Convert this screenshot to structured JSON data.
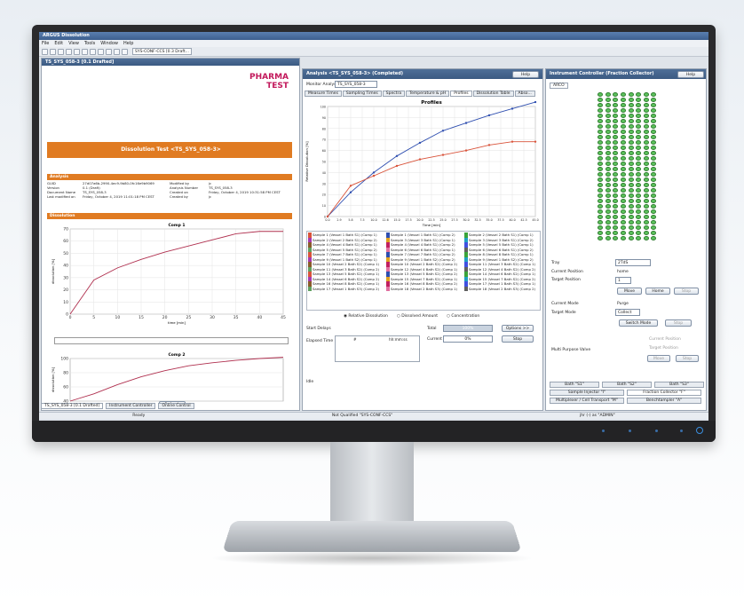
{
  "app": {
    "title": "ARGUS Dissolution",
    "menu": [
      "File",
      "Edit",
      "View",
      "Tools",
      "Window",
      "Help"
    ],
    "config_combo": "SYS-CONF-CCS [0.3 Draft..."
  },
  "left_pane": {
    "title": "TS_SYS_058-3 [0.1 Drafted]",
    "logo": "PHARMA TEST",
    "banner": "Dissolution Test <TS_SYS_058-3>",
    "analysis_header": "Analysis",
    "analysis_rows": [
      {
        "k1": "GUID",
        "v1": "27d07a6b-2990-4ec9-9b80-0fc16e9b9069",
        "k2": "Modified by",
        "v2": "jc"
      },
      {
        "k1": "Version",
        "v1": "0.1 (Draft)",
        "k2": "Analysis Number",
        "v2": "TS_SYS_058-3"
      },
      {
        "k1": "Document Name",
        "v1": "TS_SYS_058-3",
        "k2": "Created on",
        "v2": "Friday, October 4, 2019 10:31:58 PM CEST"
      },
      {
        "k1": "Last modified on",
        "v1": "Friday, October 4, 2019 11:01:18 PM CEST",
        "k2": "Created by",
        "v2": "jc"
      }
    ],
    "dissolution_header": "Dissolution",
    "refresh": "Refresh",
    "bottom_tabs": [
      "TS_SYS_058-3 [0.1 Drafted]",
      "Instrument Controller",
      "Online Control"
    ]
  },
  "chart_left1": {
    "chart_data": {
      "type": "line",
      "title": "Comp 1",
      "xlabel": "time [min]",
      "ylabel": "dissolution [%]",
      "x": [
        0,
        5,
        10,
        15,
        20,
        25,
        30,
        35,
        40,
        45
      ],
      "xticks": [
        "0",
        "5",
        "10",
        "15",
        "20",
        "25",
        "30",
        "35",
        "40",
        "45"
      ],
      "yticks": [
        "0",
        "10",
        "20",
        "30",
        "40",
        "50",
        "60",
        "70"
      ],
      "ylim": [
        0,
        70
      ],
      "series": [
        {
          "values": [
            0,
            28,
            38,
            45,
            51,
            56,
            61,
            66,
            68,
            68
          ]
        }
      ]
    }
  },
  "chart_left2": {
    "chart_data": {
      "type": "line",
      "title": "Comp 2",
      "ylabel": "dissolution [%]",
      "yticks": [
        "40",
        "60",
        "80",
        "100"
      ],
      "ylim": [
        30,
        100
      ],
      "x": [
        0,
        5,
        10,
        15,
        20,
        25,
        30,
        35,
        40,
        45
      ],
      "series": [
        {
          "values": [
            30,
            42,
            57,
            70,
            80,
            88,
            93,
            97,
            100,
            102
          ]
        }
      ]
    }
  },
  "middle_pane": {
    "title": "Analysis <TS_SYS_058-3> (Completed)",
    "help": "Help",
    "monitor_label": "Monitor Analysis",
    "monitor_value": "TS_SYS_058-3",
    "tabs": [
      "Measure Times",
      "Sampling Times",
      "Spectra",
      "Temperature & pH",
      "Profiles",
      "Dissolution Table",
      "Abso..."
    ],
    "active_tab": "Profiles",
    "radio": [
      "Relative Dissolution",
      "Dissolved Amount",
      "Concentration"
    ],
    "start_delays": "Start Delays",
    "total": "Total",
    "elapsed": "Elapsed Time",
    "hash": "#",
    "hhmmss": "hh:mm:ss",
    "current": "Current",
    "total_pct": "100%",
    "current_pct": "0%",
    "options": "Options >>",
    "stop": "Stop",
    "idle": "Idle"
  },
  "profiles_chart": {
    "chart_data": {
      "type": "line",
      "title": "Profiles",
      "xlabel": "Time [min]",
      "ylabel": "Relative Dissolution [%]",
      "ylim": [
        0,
        100
      ],
      "yticks": [
        "0",
        "10",
        "20",
        "30",
        "40",
        "50",
        "60",
        "70",
        "80",
        "90",
        "100"
      ],
      "xticks": [
        "0.0",
        "2.9",
        "5.8",
        "7.5",
        "10.0",
        "12.6",
        "15.0",
        "17.5",
        "20.0",
        "22.5",
        "25.0",
        "27.5",
        "30.0",
        "32.5",
        "35.0",
        "37.5",
        "40.0",
        "42.5",
        "45.0"
      ],
      "x": [
        0,
        5,
        10,
        15,
        20,
        25,
        30,
        35,
        40,
        45
      ],
      "series": [
        {
          "color": "#2f4fb0",
          "values": [
            0,
            22,
            40,
            55,
            67,
            78,
            85,
            92,
            98,
            104
          ]
        },
        {
          "color": "#d9533a",
          "values": [
            0,
            28,
            37,
            46,
            52,
            56,
            60,
            65,
            68,
            68
          ]
        }
      ]
    }
  },
  "legend": [
    [
      "Sample 1 (Vessel 1 Bath S1) (Comp 1)",
      "Sample 1 (Vessel 1 Bath S1) (Comp 2)",
      "Sample 2 (Vessel 2 Bath S1) (Comp 1)"
    ],
    [
      "Sample 2 (Vessel 2 Bath S1) (Comp 2)",
      "Sample 3 (Vessel 3 Bath S1) (Comp 1)",
      "Sample 3 (Vessel 3 Bath S1) (Comp 2)"
    ],
    [
      "Sample 4 (Vessel 4 Bath S1) (Comp 1)",
      "Sample 4 (Vessel 4 Bath S1) (Comp 2)",
      "Sample 5 (Vessel 5 Bath S1) (Comp 1)"
    ],
    [
      "Sample 5 (Vessel 5 Bath S1) (Comp 2)",
      "Sample 6 (Vessel 6 Bath S1) (Comp 1)",
      "Sample 6 (Vessel 6 Bath S1) (Comp 2)"
    ],
    [
      "Sample 7 (Vessel 7 Bath S1) (Comp 1)",
      "Sample 7 (Vessel 7 Bath S1) (Comp 2)",
      "Sample 8 (Vessel 8 Bath S1) (Comp 1)"
    ],
    [
      "Sample 9 (Vessel 1 Bath S2) (Comp 1)",
      "Sample 9 (Vessel 1 Bath S2) (Comp 2)",
      "Sample 9 (Vessel 1 Bath S2) (Comp 2)"
    ],
    [
      "Sample 10 (Vessel 2 Bath S2) (Comp 1)",
      "Sample 10 (Vessel 2 Bath S2) (Comp 2)",
      "Sample 11 (Vessel 3 Bath S2) (Comp 1)"
    ],
    [
      "Sample 11 (Vessel 3 Bath S2) (Comp 2)",
      "Sample 12 (Vessel 4 Bath S2) (Comp 1)",
      "Sample 12 (Vessel 4 Bath S2) (Comp 2)"
    ],
    [
      "Sample 13 (Vessel 5 Bath S2) (Comp 1)",
      "Sample 13 (Vessel 5 Bath S2) (Comp 2)",
      "Sample 14 (Vessel 6 Bath S2) (Comp 1)"
    ],
    [
      "Sample 14 (Vessel 6 Bath S2) (Comp 2)",
      "Sample 15 (Vessel 7 Bath S2) (Comp 1)",
      "Sample 15 (Vessel 7 Bath S2) (Comp 2)"
    ],
    [
      "Sample 16 (Vessel 8 Bath S2) (Comp 1)",
      "Sample 16 (Vessel 8 Bath S2) (Comp 2)",
      "Sample 17 (Vessel 1 Bath S3) (Comp 1)"
    ],
    [
      "Sample 17 (Vessel 1 Bath S3) (Comp 2)",
      "Sample 18 (Vessel 2 Bath S3) (Comp 1)",
      "Sample 18 (Vessel 2 Bath S3) (Comp 2)"
    ]
  ],
  "right_pane": {
    "title": "Instrument Controller (Fraction Collector)",
    "help": "Help",
    "tab": "ARCO",
    "tray": "Tray",
    "tray_value": "2TdS",
    "current_position": "Current Position",
    "current_position_value": "home",
    "target_position": "Target Position",
    "target_value": "1",
    "move": "Move",
    "home": "Home",
    "stop": "Stop",
    "current_mode": "Current Mode",
    "current_mode_value": "Purge",
    "target_mode": "Target Mode",
    "target_mode_value": "Collect",
    "switch_mode": "Switch Mode",
    "multi_valve": "Multi Purpose Valve",
    "mpv_current": "Current Position",
    "mpv_target": "Target Position",
    "baths": [
      "Bath \"S1\"",
      "Bath \"S2\"",
      "Bath \"S3\""
    ],
    "bottom_tabs": [
      "Sample Injector \"I\"",
      "Fraction Collector \"F\""
    ],
    "bottom_tabs2": [
      "Multiplexer / Cell Transport \"M\"",
      "Benchtampler \"A\""
    ]
  },
  "statusbar": {
    "ready": "Ready",
    "qualified": "Not Qualified \"SYS-CONF-CCS\"",
    "user": "jhr (-) as \"ADMIN\""
  }
}
